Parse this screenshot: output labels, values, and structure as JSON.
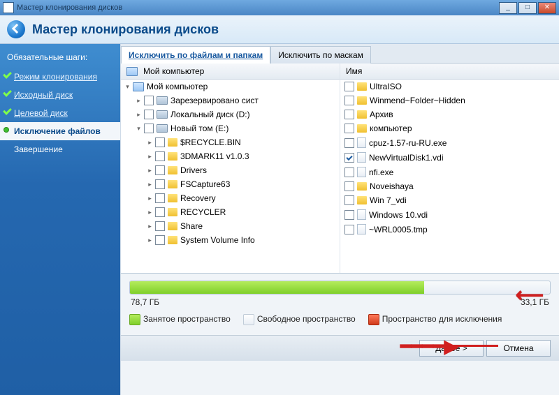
{
  "window": {
    "title": "Мастер клонирования дисков"
  },
  "header": {
    "title": "Мастер клонирования дисков"
  },
  "sidebar": {
    "heading": "Обязательные шаги:",
    "steps": [
      {
        "label": "Режим клонирования",
        "state": "done link"
      },
      {
        "label": "Исходный диск",
        "state": "done link"
      },
      {
        "label": "Целевой диск",
        "state": "done link"
      },
      {
        "label": "Исключение файлов",
        "state": "active"
      },
      {
        "label": "Завершение",
        "state": ""
      }
    ]
  },
  "tabs": {
    "left": "Исключить по файлам и папкам",
    "right": "Исключить по маскам"
  },
  "tree": {
    "header": "Мой компьютер",
    "items": [
      {
        "indent": 0,
        "icon": "pc",
        "label": "Мой компьютер",
        "exp": "▾",
        "check": null
      },
      {
        "indent": 1,
        "icon": "drive",
        "label": "Зарезервировано сист",
        "exp": "▸",
        "check": false
      },
      {
        "indent": 1,
        "icon": "drive",
        "label": "Локальный диск (D:)",
        "exp": "▸",
        "check": false
      },
      {
        "indent": 1,
        "icon": "drive",
        "label": "Новый том (E:)",
        "exp": "▾",
        "check": false
      },
      {
        "indent": 2,
        "icon": "folder",
        "label": "$RECYCLE.BIN",
        "exp": "▸",
        "check": false
      },
      {
        "indent": 2,
        "icon": "folder",
        "label": "3DMARK11 v1.0.3",
        "exp": "▸",
        "check": false
      },
      {
        "indent": 2,
        "icon": "folder",
        "label": "Drivers",
        "exp": "▸",
        "check": false
      },
      {
        "indent": 2,
        "icon": "folder",
        "label": "FSCapture63",
        "exp": "▸",
        "check": false
      },
      {
        "indent": 2,
        "icon": "folder",
        "label": "Recovery",
        "exp": "▸",
        "check": false
      },
      {
        "indent": 2,
        "icon": "folder",
        "label": "RECYCLER",
        "exp": "▸",
        "check": false
      },
      {
        "indent": 2,
        "icon": "folder",
        "label": "Share",
        "exp": "▸",
        "check": false
      },
      {
        "indent": 2,
        "icon": "folder",
        "label": "System Volume Info",
        "exp": "▸",
        "check": false
      }
    ]
  },
  "list": {
    "header": "Имя",
    "items": [
      {
        "icon": "folder",
        "label": "UltraISO",
        "check": false
      },
      {
        "icon": "folder",
        "label": "Winmend~Folder~Hidden",
        "check": false
      },
      {
        "icon": "folder",
        "label": "Архив",
        "check": false
      },
      {
        "icon": "folder",
        "label": "компьютер",
        "check": false
      },
      {
        "icon": "file",
        "label": "cpuz-1.57-ru-RU.exe",
        "check": false
      },
      {
        "icon": "file",
        "label": "NewVirtualDisk1.vdi",
        "check": true
      },
      {
        "icon": "file",
        "label": "nfi.exe",
        "check": false
      },
      {
        "icon": "folder",
        "label": "Noveishaya",
        "check": false
      },
      {
        "icon": "folder",
        "label": "Win 7_vdi",
        "check": false
      },
      {
        "icon": "file",
        "label": "Windows 10.vdi",
        "check": false
      },
      {
        "icon": "file",
        "label": "~WRL0005.tmp",
        "check": false
      }
    ]
  },
  "progress": {
    "used_pct": 70,
    "left_label": "78,7 ГБ",
    "right_label": "33,1 ГБ"
  },
  "legend": {
    "used": "Занятое пространство",
    "free": "Свободное пространство",
    "excl": "Пространство для исключения"
  },
  "footer": {
    "next": "Далее >",
    "cancel": "Отмена"
  }
}
